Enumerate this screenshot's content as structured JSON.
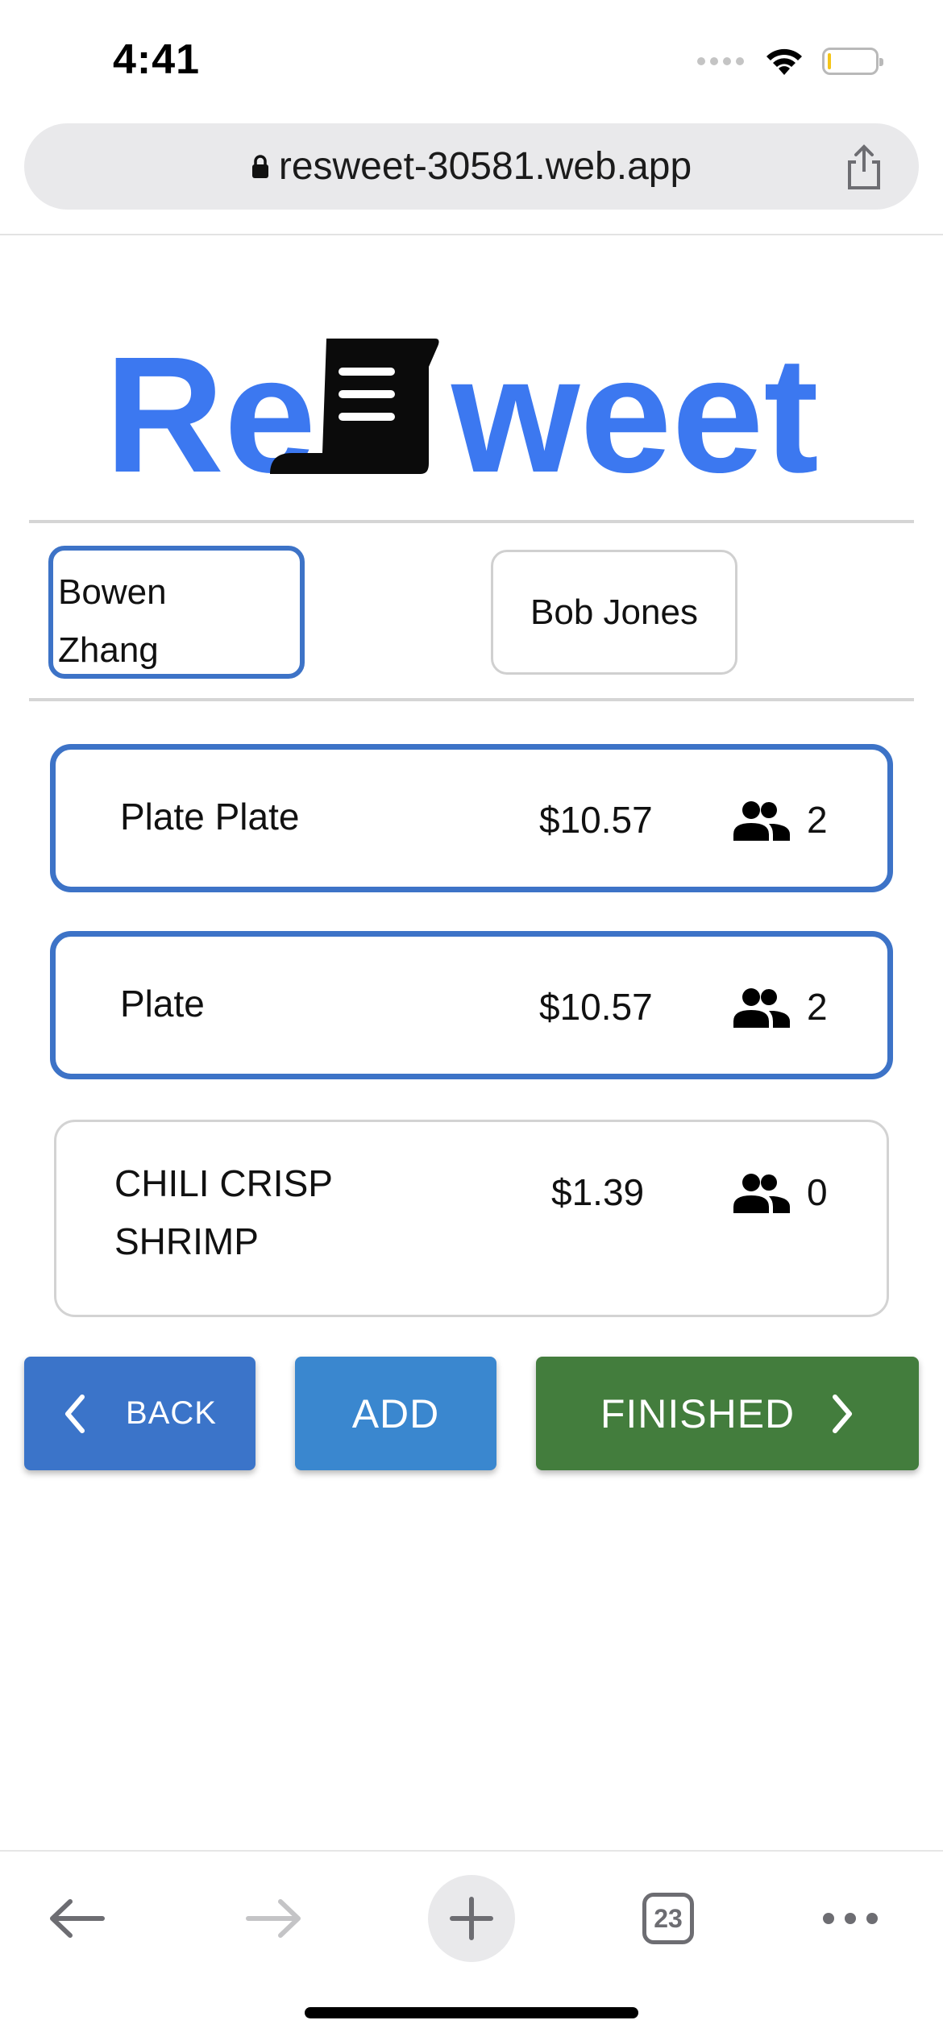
{
  "status_bar": {
    "time": "4:41"
  },
  "browser": {
    "url": "resweet-30581.web.app",
    "tab_count": "23"
  },
  "app": {
    "logo_text_left": "Re",
    "logo_text_right": "weet",
    "brand_color": "#3c78f0"
  },
  "people": [
    {
      "name_line1": "Bowen",
      "name_line2": "Zhang",
      "selected": true
    },
    {
      "name": "Bob Jones",
      "selected": false
    }
  ],
  "items": [
    {
      "name": "Plate Plate",
      "price": "$10.57",
      "count": "2",
      "selected": true
    },
    {
      "name": "Plate",
      "price": "$10.57",
      "count": "2",
      "selected": true
    },
    {
      "name_line1": "CHILI CRISP",
      "name_line2": "SHRIMP",
      "price": "$1.39",
      "count": "0",
      "selected": false
    }
  ],
  "buttons": {
    "back": "BACK",
    "add": "ADD",
    "finished": "FINISHED"
  },
  "colors": {
    "selected_border": "#3d73c7",
    "back_button": "#3b74c9",
    "add_button": "#3a87cf",
    "finished_button": "#437d3d"
  }
}
